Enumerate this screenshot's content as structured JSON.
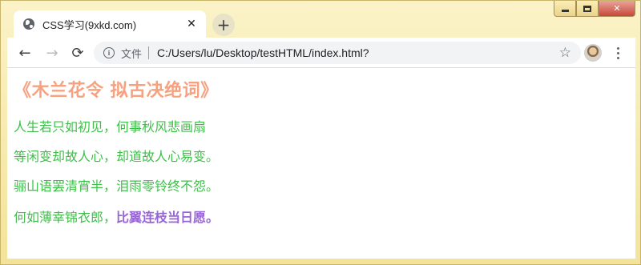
{
  "browser": {
    "tab_title": "CSS学习(9xkd.com)",
    "tab_close": "✕",
    "new_tab": "+",
    "back": "←",
    "forward": "→",
    "reload": "⟳",
    "info_icon": "i",
    "scheme_label": "文件",
    "url": "C:/Users/lu/Desktop/testHTML/index.html?",
    "bookmark_icon": "☆",
    "window_close": "✕"
  },
  "icons": {
    "favicon": "globe-icon",
    "back": "arrow-left-icon",
    "forward": "arrow-right-icon",
    "reload": "reload-icon",
    "info": "info-icon",
    "bookmark": "star-icon",
    "menu": "kebab-menu-icon",
    "profile": "avatar"
  },
  "page": {
    "title": "《木兰花令 拟古决绝词》",
    "lines": [
      "人生若只如初见，何事秋风悲画扇",
      "等闲变却故人心，却道故人心易变。",
      "骊山语罢清宵半，泪雨零铃终不怨。"
    ],
    "last_line_plain": "何如薄幸锦衣郎，",
    "last_line_highlight": "比翼连枝当日愿。"
  },
  "colors": {
    "title": "#f6a17f",
    "text": "#3fbf4a",
    "highlight": "#9865d6"
  }
}
